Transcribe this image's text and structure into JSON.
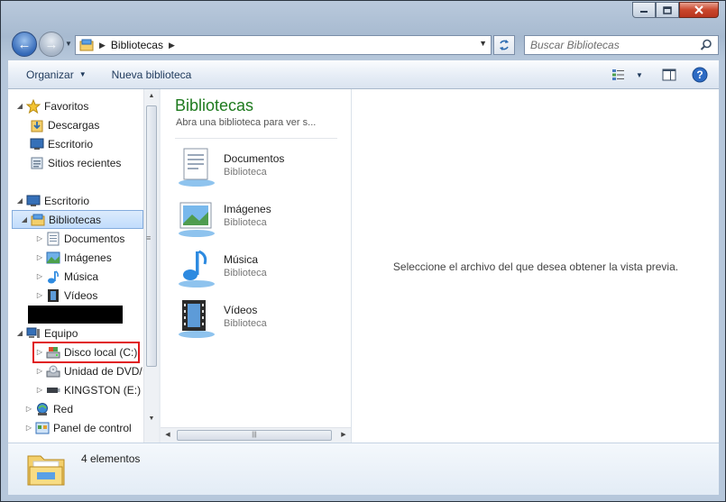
{
  "address": {
    "crumb": "Bibliotecas",
    "search_placeholder": "Buscar Bibliotecas"
  },
  "toolbar": {
    "organize_label": "Organizar",
    "new_library_label": "Nueva biblioteca"
  },
  "navpane": {
    "items": [
      {
        "label": "Favoritos",
        "icon": "star-icon"
      },
      {
        "label": "Descargas",
        "icon": "downloads-icon"
      },
      {
        "label": "Escritorio",
        "icon": "desktop-icon"
      },
      {
        "label": "Sitios recientes",
        "icon": "recent-places-icon"
      },
      {
        "label": "Escritorio",
        "icon": "desktop-icon"
      },
      {
        "label": "Bibliotecas",
        "icon": "libraries-icon"
      },
      {
        "label": "Documentos",
        "icon": "documents-icon"
      },
      {
        "label": "Imágenes",
        "icon": "pictures-icon"
      },
      {
        "label": "Música",
        "icon": "music-icon"
      },
      {
        "label": "Vídeos",
        "icon": "videos-icon"
      },
      {
        "label": "Equipo",
        "icon": "computer-icon"
      },
      {
        "label": "Disco local (C:)",
        "icon": "local-disk-icon"
      },
      {
        "label": "Unidad de DVD/",
        "icon": "dvd-drive-icon"
      },
      {
        "label": "KINGSTON (E:)",
        "icon": "usb-drive-icon"
      },
      {
        "label": "Red",
        "icon": "network-icon"
      },
      {
        "label": "Panel de control",
        "icon": "control-panel-icon"
      }
    ]
  },
  "filepane": {
    "title": "Bibliotecas",
    "subtitle": "Abra una biblioteca para ver s...",
    "items": [
      {
        "name": "Documentos",
        "type": "Biblioteca",
        "icon": "documents-library-icon"
      },
      {
        "name": "Imágenes",
        "type": "Biblioteca",
        "icon": "pictures-library-icon"
      },
      {
        "name": "Música",
        "type": "Biblioteca",
        "icon": "music-library-icon"
      },
      {
        "name": "Vídeos",
        "type": "Biblioteca",
        "icon": "videos-library-icon"
      }
    ]
  },
  "preview": {
    "message": "Seleccione el archivo del que desea obtener la vista previa."
  },
  "status": {
    "count": "4 elementos"
  },
  "colors": {
    "accent_title": "#1e7a1e",
    "selection": "#c1dcfc",
    "highlight_box": "#e0191d",
    "close_button": "#c9462c"
  }
}
